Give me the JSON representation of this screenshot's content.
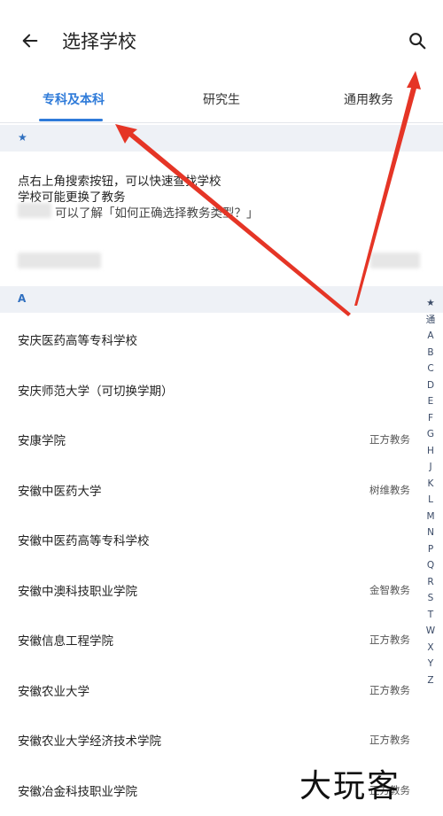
{
  "header": {
    "title": "选择学校",
    "back_icon": "arrow-left-icon",
    "search_icon": "search-icon"
  },
  "tabs": [
    {
      "label": "专科及本科",
      "active": true
    },
    {
      "label": "研究生",
      "active": false
    },
    {
      "label": "通用教务",
      "active": false
    }
  ],
  "star_section": {
    "header": "★"
  },
  "tips": {
    "line1": "点右上角搜索按钮，可以快速查找学校",
    "line2": "学校可能更换了教务",
    "line3": "可以了解「如何正确选择教务类型？」"
  },
  "section_a": {
    "header": "A"
  },
  "schools": [
    {
      "name": "安庆医药高等专科学校",
      "system": ""
    },
    {
      "name": "安庆师范大学（可切换学期）",
      "system": ""
    },
    {
      "name": "安康学院",
      "system": "正方教务"
    },
    {
      "name": "安徽中医药大学",
      "system": "树维教务"
    },
    {
      "name": "安徽中医药高等专科学校",
      "system": ""
    },
    {
      "name": "安徽中澳科技职业学院",
      "system": "金智教务"
    },
    {
      "name": "安徽信息工程学院",
      "system": "正方教务"
    },
    {
      "name": "安徽农业大学",
      "system": "正方教务"
    },
    {
      "name": "安徽农业大学经济技术学院",
      "system": "正方教务"
    },
    {
      "name": "安徽冶金科技职业学院",
      "system": "正方教务"
    }
  ],
  "index_letters": [
    "★",
    "通",
    "A",
    "B",
    "C",
    "D",
    "E",
    "F",
    "G",
    "H",
    "J",
    "K",
    "L",
    "M",
    "N",
    "P",
    "Q",
    "R",
    "S",
    "T",
    "W",
    "X",
    "Y",
    "Z"
  ],
  "watermark": "大玩客",
  "colors": {
    "accent": "#2f7bd9",
    "section_bg": "#eef1f6",
    "annotation_arrow": "#e53526"
  }
}
